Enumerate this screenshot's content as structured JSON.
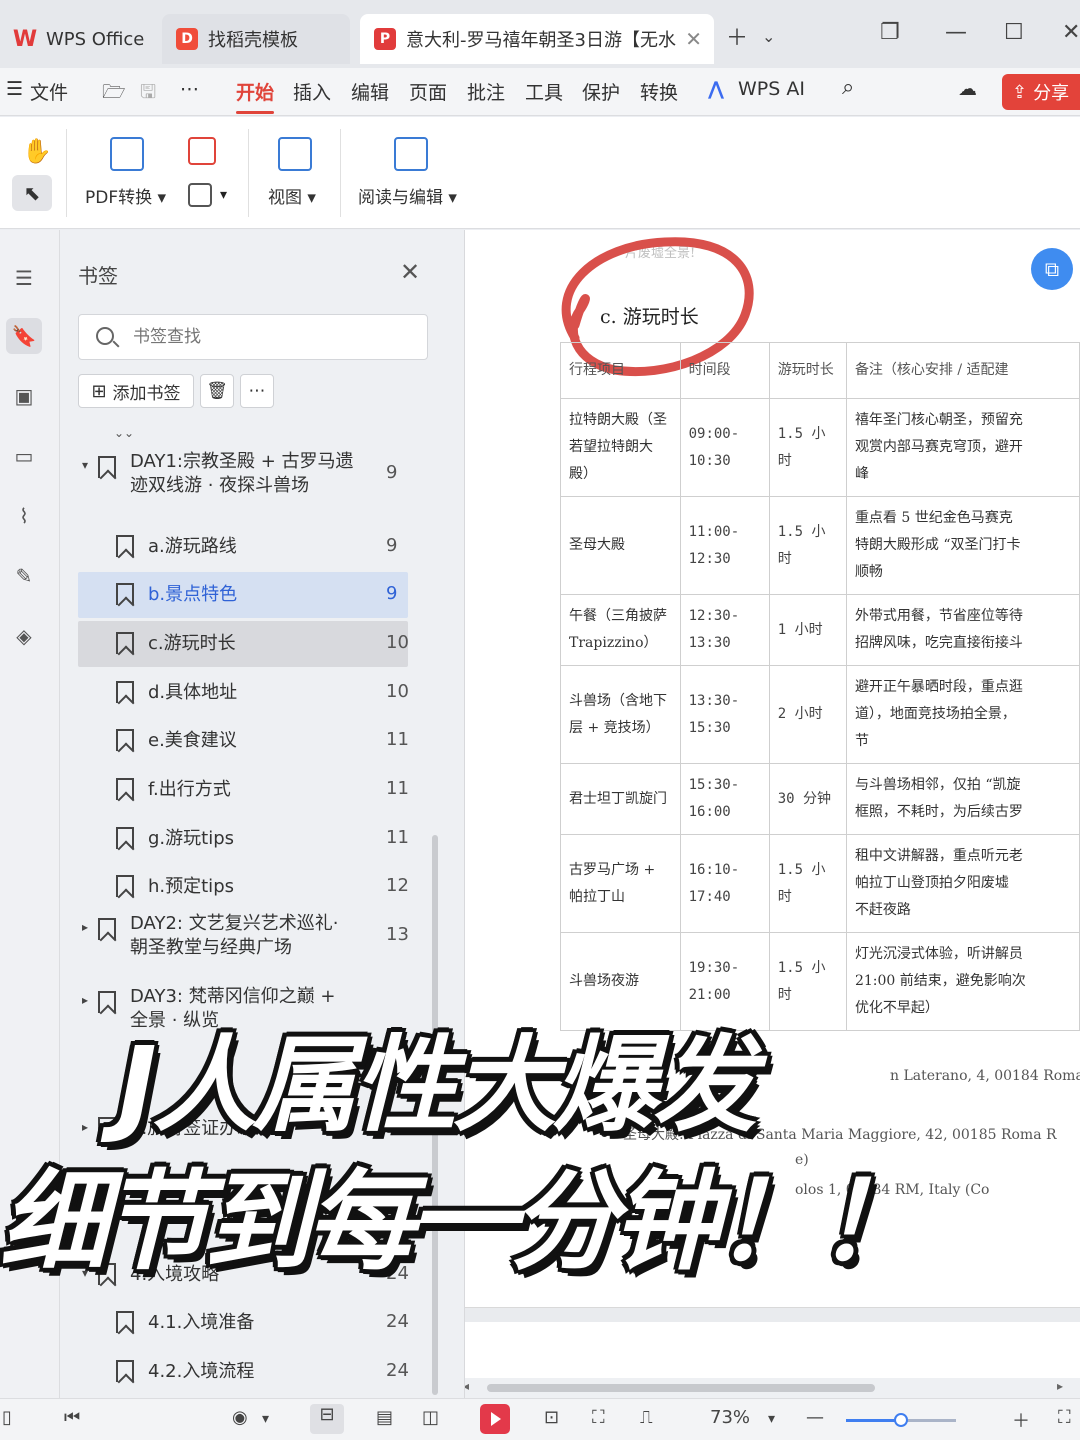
{
  "tabs": [
    {
      "label": "WPS Office"
    },
    {
      "label": "找稻壳模板"
    },
    {
      "label": "意大利-罗马禧年朝圣3日游【无水"
    }
  ],
  "menu": {
    "file": "文件",
    "items": [
      "开始",
      "插入",
      "编辑",
      "页面",
      "批注",
      "工具",
      "保护",
      "转换"
    ],
    "ai": "WPS AI",
    "share": "分享"
  },
  "ribbon": {
    "pdf_convert": "PDF转换",
    "view": "视图",
    "read_edit": "阅读与编辑"
  },
  "panel": {
    "title": "书签",
    "search_placeholder": "书签查找",
    "add_bookmark": "添加书签"
  },
  "bookmarks": [
    {
      "text": "DAY1:宗教圣殿 + 古罗马遗",
      "text2": "迹双线游 · 夜探斗兽场",
      "page": "9",
      "level": 0,
      "expanded": true
    },
    {
      "text": "a.游玩路线",
      "page": "9",
      "level": 1
    },
    {
      "text": "b.景点特色",
      "page": "9",
      "level": 1,
      "selected": true
    },
    {
      "text": "c.游玩时长",
      "page": "10",
      "level": 1,
      "hover": true
    },
    {
      "text": "d.具体地址",
      "page": "10",
      "level": 1
    },
    {
      "text": "e.美食建议",
      "page": "11",
      "level": 1
    },
    {
      "text": "f.出行方式",
      "page": "11",
      "level": 1
    },
    {
      "text": "g.游玩tips",
      "page": "11",
      "level": 1
    },
    {
      "text": "h.预定tips",
      "page": "12",
      "level": 1
    },
    {
      "text": "DAY2: 文艺复兴艺术巡礼·",
      "text2": "朝圣教堂与经典广场",
      "page": "13",
      "level": 0
    },
    {
      "text": "DAY3: 梵蒂冈信仰之巅 +",
      "text2": "全景 · 纵览",
      "page": "",
      "level": 0
    },
    {
      "text": "1.旅游签证办理",
      "page": "21",
      "level": 0
    },
    {
      "text": "4.入境攻略",
      "page": "24",
      "level": 0,
      "expanded": true
    },
    {
      "text": "4.1.入境准备",
      "page": "24",
      "level": 1
    },
    {
      "text": "4.2.入境流程",
      "page": "24",
      "level": 1
    }
  ],
  "doc": {
    "faint_line": "片废墟全景!",
    "heading": "c. 游玩时长",
    "table": {
      "headers": [
        "行程项目",
        "时间段",
        "游玩时长",
        "备注（核心安排 / 适配建"
      ],
      "rows": [
        {
          "item": "拉特朗大殿（圣若望拉特朗大殿）",
          "time": "09:00-10:30",
          "dur": "1.5 小时",
          "note": [
            "禧年圣门核心朝圣，预留充",
            "观赏内部马赛克穹顶，避开",
            "峰"
          ]
        },
        {
          "item": "圣母大殿",
          "time": "11:00-12:30",
          "dur": "1.5 小时",
          "note": [
            "重点看 5 世纪金色马赛克",
            "特朗大殿形成 “双圣门打卡",
            "顺畅"
          ]
        },
        {
          "item": "午餐（三角披萨 Trapizzino）",
          "time": "12:30-13:30",
          "dur": "1 小时",
          "note": [
            "外带式用餐，节省座位等待",
            "招牌风味，吃完直接衔接斗"
          ]
        },
        {
          "item": "斗兽场（含地下层 + 竞技场）",
          "time": "13:30-15:30",
          "dur": "2 小时",
          "note": [
            "避开正午暴晒时段，重点逛",
            "道），地面竞技场拍全景，",
            "节"
          ]
        },
        {
          "item": "君士坦丁凯旋门",
          "time": "15:30-16:00",
          "dur": "30 分钟",
          "note": [
            "与斗兽场相邻，仅拍 “凯旋",
            "框照，不耗时，为后续古罗"
          ]
        },
        {
          "item": "古罗马广场 + 帕拉丁山",
          "time": "16:10-17:40",
          "dur": "1.5 小时",
          "note": [
            "租中文讲解器，重点听元老",
            "帕拉丁山登顶拍夕阳废墟",
            "不赶夜路"
          ]
        },
        {
          "item": "斗兽场夜游",
          "time": "19:30-21:00",
          "dur": "1.5 小时",
          "note": [
            "灯光沉浸式体验，听讲解员",
            "21:00 前结束，避免影响次",
            "优化不早起）"
          ]
        }
      ]
    },
    "addr_lines": [
      "n Laterano, 4, 00184 Roma",
      "圣母大殿: Piazza di Santa Maria Maggiore, 42, 00185 Roma R",
      "e)",
      "olos    1, 00184 RM, Italy (Co"
    ]
  },
  "status": {
    "zoom": "73%",
    "zoom_level": 0.5
  },
  "caption": {
    "line1": "J人属性大爆发",
    "line2": "细节到每一分钟！！"
  }
}
